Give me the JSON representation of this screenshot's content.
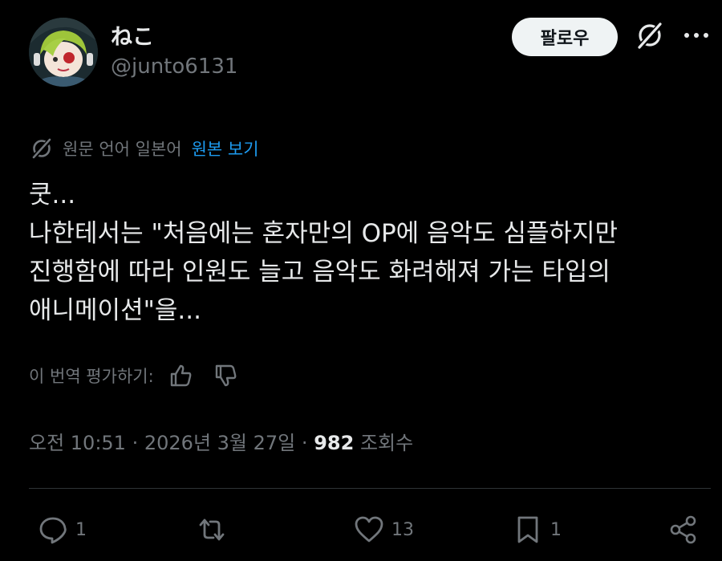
{
  "author": {
    "display_name": "ねこ",
    "handle": "@junto6131",
    "follow_label": "팔로우"
  },
  "translation": {
    "note": "원문 언어 일본어",
    "show_original": "원본 보기"
  },
  "tweet": {
    "lines": [
      "쿳...",
      "나한테서는 \"처음에는 혼자만의 OP에 음악도 심플하지만",
      "진행함에 따라 인원도 늘고 음악도 화려해져 가는 타입의",
      "애니메이션\"을..."
    ]
  },
  "rating": {
    "label": "이 번역 평가하기:"
  },
  "meta": {
    "time": "오전 10:51",
    "separator": "·",
    "date": "2026년 3월 27일",
    "views_count": "982",
    "views_label": "조회수"
  },
  "actions": {
    "reply_count": "1",
    "retweet_count": "",
    "like_count": "13",
    "bookmark_count": "1"
  },
  "colors": {
    "background": "#000000",
    "text": "#e7e9ea",
    "muted": "#71767b",
    "link": "#1d9bf0",
    "divider": "#2f3336"
  }
}
